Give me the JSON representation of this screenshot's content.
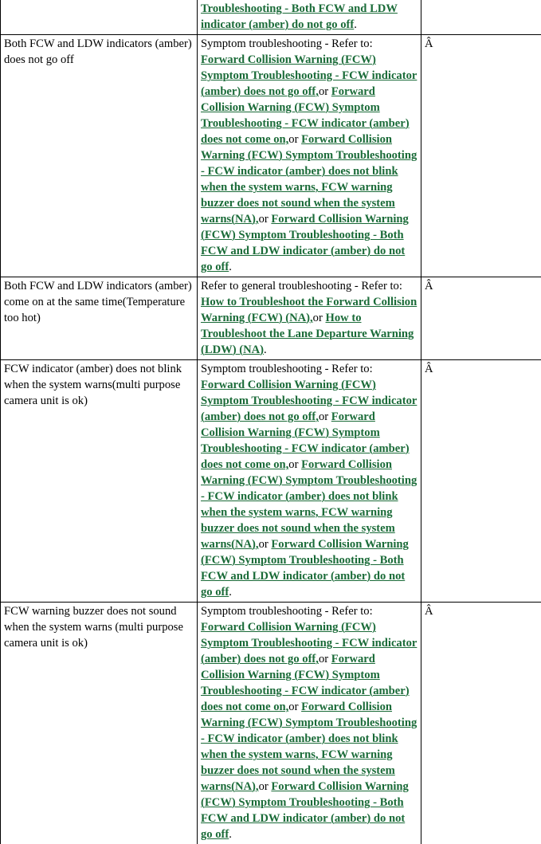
{
  "document": {
    "type": "service-manual-symptom-table",
    "colors": {
      "link_green": "#1a6b38",
      "text_black": "#000000",
      "border_black": "#000000",
      "background": "#ffffff"
    },
    "conjunction": "or",
    "period": ".",
    "note_char": "Â"
  },
  "links": {
    "fcw_indicator_does_not_go_off": "Forward Collision Warning (FCW) Symptom Troubleshooting - FCW indicator (amber) does not go off,",
    "fcw_indicator_does_not_come_on": "Forward Collision Warning (FCW) Symptom Troubleshooting - FCW indicator (amber) does not come on,",
    "fcw_indicator_does_not_blink": "Forward Collision Warning (FCW) Symptom Troubleshooting - FCW indicator (amber) does not blink when the system warns, FCW warning buzzer does not sound when the system warns(NA),",
    "both_fcw_ldw_do_not_go_off": "Forward Collision Warning (FCW) Symptom Troubleshooting - Both FCW and LDW indicator (amber) do not go off",
    "both_fcw_ldw_do_not_go_off_tail": "Troubleshooting - Both FCW and LDW indicator (amber) do not go off",
    "how_to_troubleshoot_fcw": "How to Troubleshoot the Forward Collision Warning (FCW) (NA),",
    "how_to_troubleshoot_ldw": "How to Troubleshoot the Lane Departure Warning (LDW) (NA)"
  },
  "rows": [
    {
      "id": "row-clipped-top",
      "symptom": "",
      "action_lead": "",
      "note": ""
    },
    {
      "id": "row-both-indicators-not-go-off",
      "symptom": "Both FCW and LDW indicators (amber) does not go off",
      "action_lead": "Symptom troubleshooting - Refer to:",
      "note": "Â"
    },
    {
      "id": "row-both-indicators-come-on-same-time",
      "symptom": "Both FCW and LDW indicators (amber) come on at the same time(Temperature too hot)",
      "action_lead": "Refer to general troubleshooting - Refer to:",
      "note": "Â"
    },
    {
      "id": "row-fcw-indicator-not-blink",
      "symptom": "FCW indicator (amber) does not blink when the system warns(multi purpose camera unit is ok)",
      "action_lead": "Symptom troubleshooting - Refer to:",
      "note": "Â"
    },
    {
      "id": "row-fcw-buzzer-not-sound",
      "symptom": "FCW warning buzzer does not sound when the system warns (multi purpose camera unit is ok)",
      "action_lead": "Symptom troubleshooting - Refer to:",
      "note": "Â"
    }
  ]
}
